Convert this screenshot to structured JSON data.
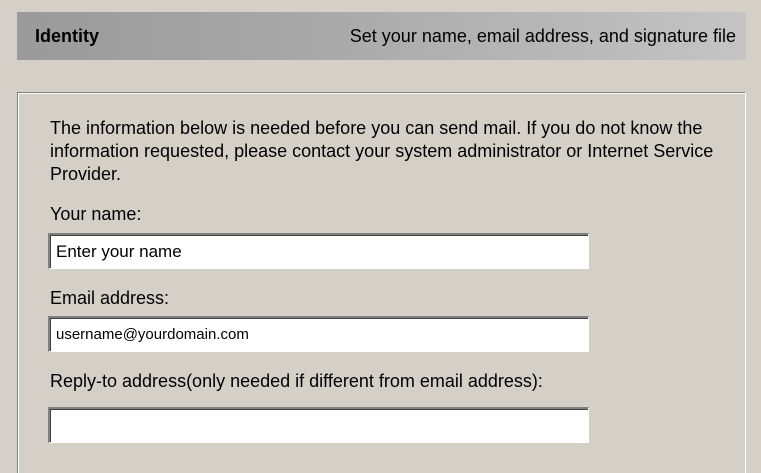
{
  "header": {
    "title": "Identity",
    "description": "Set your name, email address, and signature file"
  },
  "intro_text": "The information below is needed before you can send mail.  If you do not know the information requested, please contact your system administrator or Internet Service Provider.",
  "fields": {
    "name": {
      "label": "Your name:",
      "value": "Enter your name"
    },
    "email": {
      "label": "Email address:",
      "value": "username@yourdomain.com"
    },
    "reply_to": {
      "label": "Reply-to address(only needed if different from email address):",
      "value": ""
    }
  }
}
